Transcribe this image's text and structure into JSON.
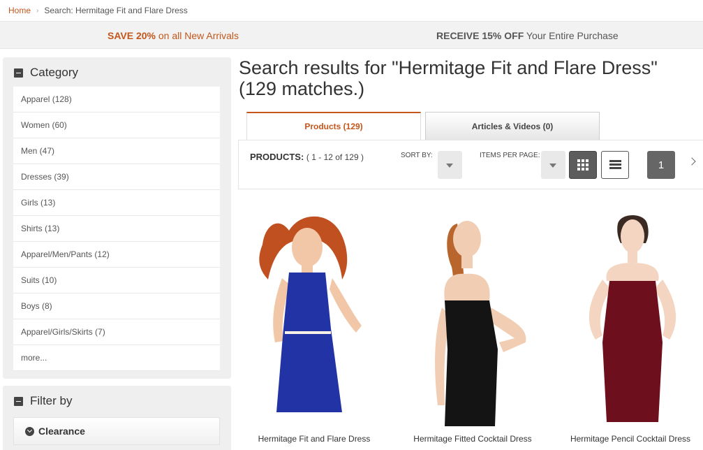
{
  "breadcrumb": {
    "home": "Home",
    "current": "Search: Hermitage Fit and Flare Dress"
  },
  "promo": {
    "left_bold": "SAVE 20%",
    "left_rest": " on all New Arrivals",
    "right_bold": "RECEIVE 15% OFF",
    "right_rest": " Your Entire Purchase"
  },
  "sidebar": {
    "category_title": "Category",
    "categories": [
      "Apparel (128)",
      "Women (60)",
      "Men (47)",
      "Dresses (39)",
      "Girls (13)",
      "Shirts (13)",
      "Apparel/Men/Pants (12)",
      "Suits (10)",
      "Boys (8)",
      "Apparel/Girls/Skirts (7)",
      "more..."
    ],
    "filter_title": "Filter by",
    "filter_clearance": "Clearance"
  },
  "main": {
    "title": "Search results for \"Hermitage Fit and Flare Dress\" (129 matches.)",
    "tabs": [
      {
        "label": "Products (129)"
      },
      {
        "label": "Articles & Videos (0)"
      }
    ],
    "toolbar": {
      "products_label": "PRODUCTS:",
      "range": "(   1 - 12 of 129   )",
      "sort_by_label": "SORT BY:",
      "items_per_page_label": "ITEMS PER PAGE:",
      "page": "1"
    },
    "products": [
      {
        "name": "Hermitage Fit and Flare Dress",
        "dress_color": "#2233a6"
      },
      {
        "name": "Hermitage Fitted Cocktail Dress",
        "dress_color": "#141414"
      },
      {
        "name": "Hermitage Pencil Cocktail Dress",
        "dress_color": "#6e0f1e"
      }
    ]
  },
  "colors": {
    "accent": "#c5561b"
  }
}
